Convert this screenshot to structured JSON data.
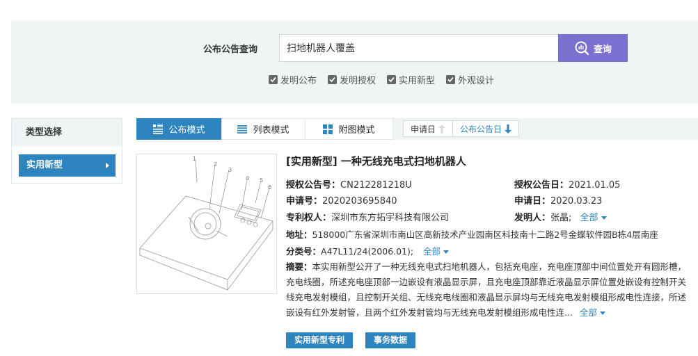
{
  "search": {
    "label": "公布公告查询",
    "value": "扫地机器人覆盖",
    "button_label": "查询",
    "filters": [
      {
        "label": "发明公布",
        "checked": true
      },
      {
        "label": "发明授权",
        "checked": true
      },
      {
        "label": "实用新型",
        "checked": true
      },
      {
        "label": "外观设计",
        "checked": true
      }
    ]
  },
  "type_panel": {
    "header": "类型选择",
    "selected": "实用新型"
  },
  "modes": {
    "tabs": [
      "公布模式",
      "列表模式",
      "附图模式"
    ],
    "active": "公布模式",
    "sort": [
      {
        "label": "申请日",
        "direction": "up",
        "active": false
      },
      {
        "label": "公布公告日",
        "direction": "down",
        "active": true
      }
    ]
  },
  "result": {
    "title": "[实用新型] 一种无线充电式扫地机器人",
    "fields": {
      "grant_no_label": "授权公告号：",
      "grant_no": "CN212281218U",
      "grant_date_label": "授权公告日：",
      "grant_date": "2021.01.05",
      "app_no_label": "申请号：",
      "app_no": "2020203695840",
      "app_date_label": "申请日：",
      "app_date": "2020.03.23",
      "owner_label": "专利权人：",
      "owner": "深圳市东方拓宇科技有限公司",
      "inventor_label": "发明人：",
      "inventor": "张晶;",
      "address_label": "地址：",
      "address": "518000广东省深圳市南山区高新技术产业园南区科技南十二路2号金蝶软件园B栋4层南座",
      "class_label": "分类号：",
      "class": "A47L11/24(2006.01);",
      "abstract_label": "摘要：",
      "abstract_lines": [
        "本实用新型公开了一种无线充电式扫地机器人，包括充电座，充电座顶部中间位置处开有圆形槽，",
        "充电线圈，所述充电座顶部一边嵌设有液晶显示屏，且充电座顶部靠近液晶显示屏位置处嵌设有控制开关",
        "线充电发射模组，且控制开关组、无线充电线圈和液晶显示屏均与无线充电发射模组形成电性连接，所述",
        "嵌设有红外发射管，且两个红外发射管均与无线充电发射模组形成电性连..."
      ]
    },
    "more_label": "全部",
    "buttons": [
      "实用新型专利",
      "事务数据"
    ],
    "drawing_labels": [
      "1",
      "2",
      "3",
      "4",
      "5",
      "6"
    ]
  },
  "colors": {
    "accent": "#2e84bf",
    "search_button": "#7b6fd0",
    "panel_bg": "#eef5f4"
  }
}
